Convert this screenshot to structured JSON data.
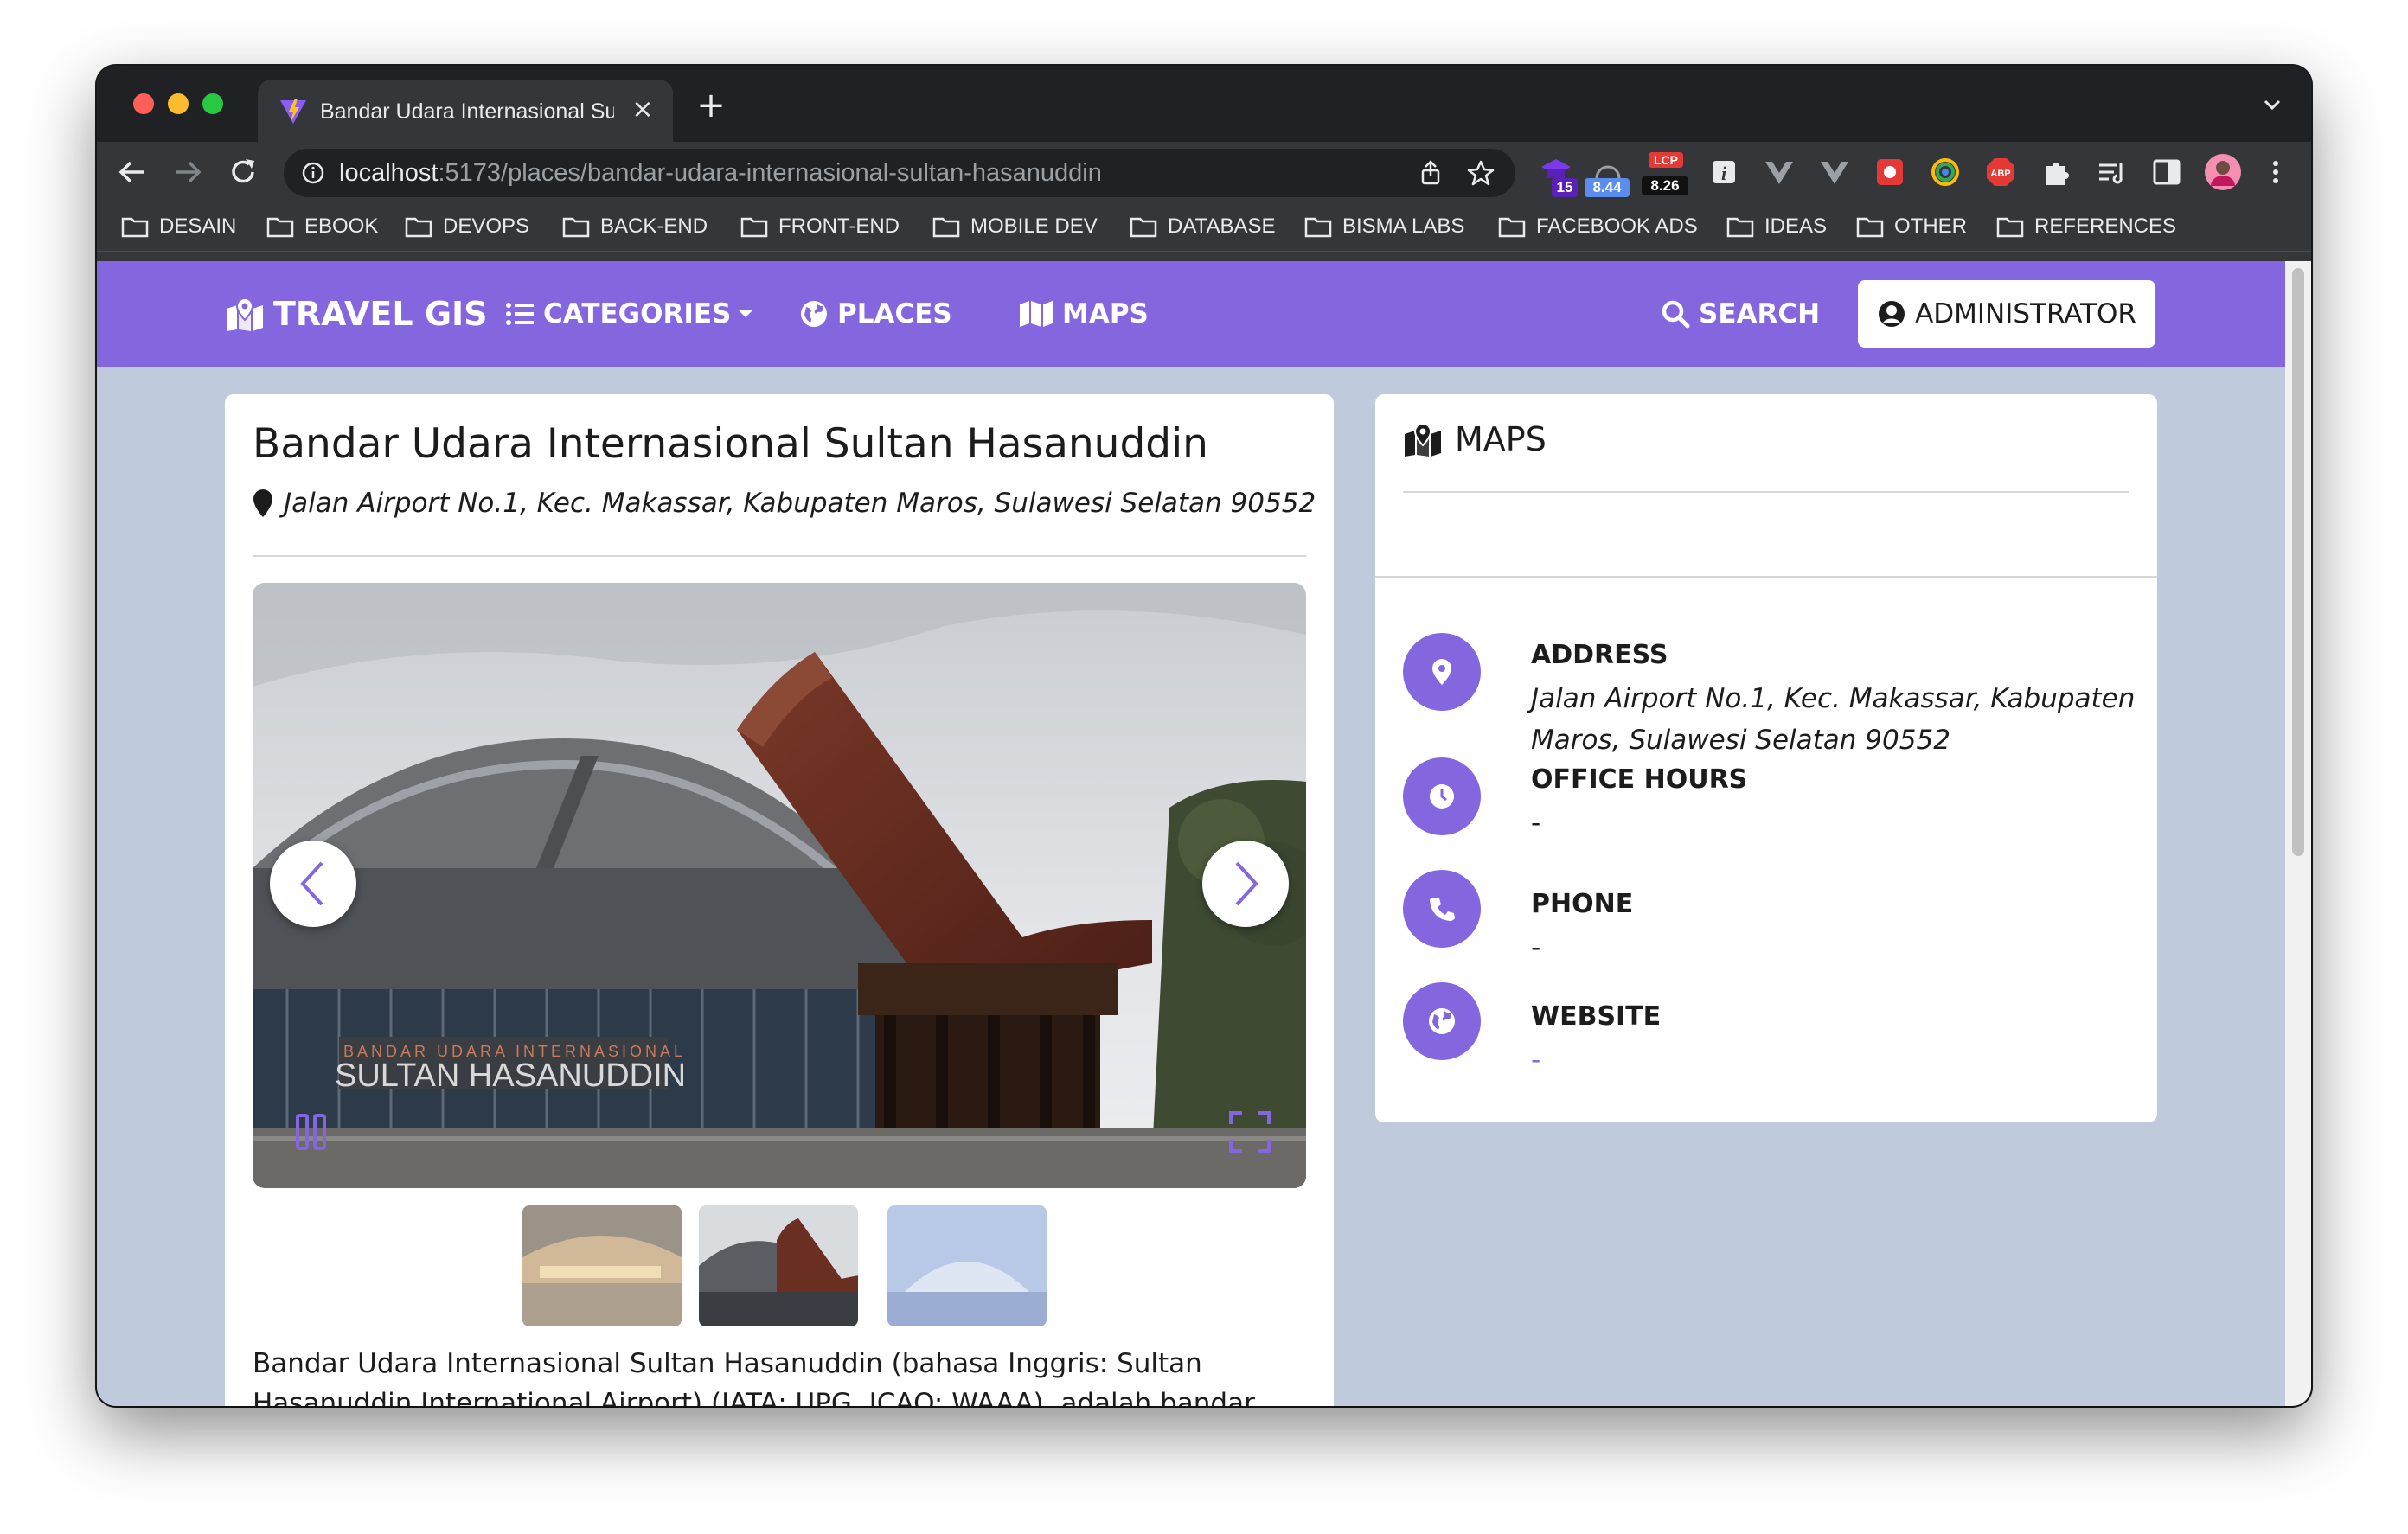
{
  "browser": {
    "tab_title": "Bandar Udara Internasional Sultan Hasanuddin",
    "new_tab_symbol": "+",
    "close_symbol": "×",
    "url_host": "localhost",
    "url_path": ":5173/places/bandar-udara-internasional-sultan-hasanuddin",
    "extension_badges": {
      "ext1": "15",
      "ext2": "8.44",
      "lcp_label": "LCP",
      "lcp_value": "8.26",
      "abp": "ABP"
    },
    "bookmarks": [
      "DESAIN",
      "EBOOK",
      "DEVOPS",
      "BACK-END",
      "FRONT-END",
      "MOBILE DEV",
      "DATABASE",
      "BISMA LABS",
      "FACEBOOK ADS",
      "IDEAS",
      "OTHER",
      "REFERENCES"
    ]
  },
  "navbar": {
    "brand": "TRAVEL GIS",
    "categories": "CATEGORIES",
    "places": "PLACES",
    "maps": "MAPS",
    "search": "SEARCH",
    "admin": "ADMINISTRATOR",
    "color": "#8466df"
  },
  "place": {
    "title": "Bandar Udara Internasional Sultan Hasanuddin",
    "address": "Jalan Airport No.1, Kec. Makassar, Kabupaten Maros, Sulawesi Selatan 90552",
    "photo_sign_top": "BANDAR UDARA INTERNASIONAL",
    "photo_sign_main": "SULTAN HASANUDDIN",
    "description": "Bandar Udara Internasional Sultan Hasanuddin (bahasa Inggris: Sultan Hasanuddin International Airport) (IATA: UPG, ICAO: WAAA), adalah bandar udara"
  },
  "sidebar": {
    "maps_title": "MAPS",
    "address_label": "ADDRESS",
    "address_value": "Jalan Airport No.1, Kec. Makassar, Kabupaten Maros, Sulawesi Selatan 90552",
    "hours_label": "OFFICE HOURS",
    "hours_value": "-",
    "phone_label": "PHONE",
    "phone_value": "-",
    "website_label": "WEBSITE",
    "website_value": "-"
  },
  "icons": {
    "brand": "map-location-icon",
    "categories": "list-icon",
    "places": "globe-icon",
    "maps": "map-icon",
    "search": "search-icon",
    "admin": "user-circle-icon",
    "address": "map-pin-icon",
    "hours": "clock-icon",
    "phone": "phone-icon",
    "website": "globe-icon"
  }
}
